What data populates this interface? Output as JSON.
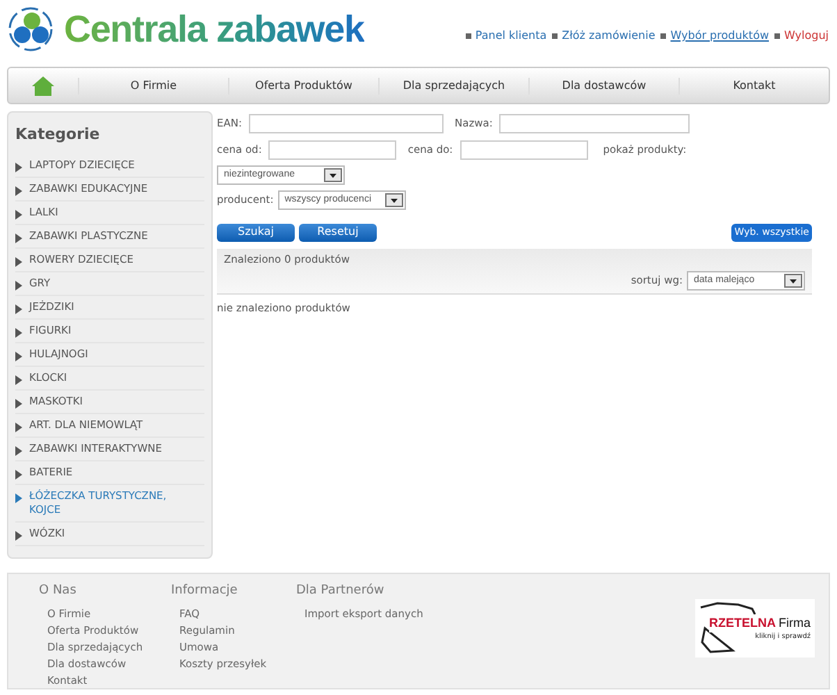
{
  "logo": {
    "text": "Centrala zabawek"
  },
  "top_links": [
    {
      "label": "Panel klienta",
      "kind": "normal"
    },
    {
      "label": "Złóż zamówienie",
      "kind": "normal"
    },
    {
      "label": "Wybór produktów",
      "kind": "current"
    },
    {
      "label": "Wyloguj",
      "kind": "logout"
    }
  ],
  "nav": [
    "O Firmie",
    "Oferta Produktów",
    "Dla sprzedających",
    "Dla dostawców",
    "Kontakt"
  ],
  "sidebar": {
    "title": "Kategorie",
    "items": [
      {
        "label": "LAPTOPY DZIECIĘCE",
        "selected": false
      },
      {
        "label": "ZABAWKI EDUKACYJNE",
        "selected": false
      },
      {
        "label": "LALKI",
        "selected": false
      },
      {
        "label": "ZABAWKI PLASTYCZNE",
        "selected": false
      },
      {
        "label": "ROWERY DZIECIĘCE",
        "selected": false
      },
      {
        "label": "GRY",
        "selected": false
      },
      {
        "label": "JEŻDZIKI",
        "selected": false
      },
      {
        "label": "FIGURKI",
        "selected": false
      },
      {
        "label": "HULAJNOGI",
        "selected": false
      },
      {
        "label": "KLOCKI",
        "selected": false
      },
      {
        "label": "MASKOTKI",
        "selected": false
      },
      {
        "label": "ART. DLA NIEMOWLĄT",
        "selected": false
      },
      {
        "label": "ZABAWKI INTERAKTYWNE",
        "selected": false
      },
      {
        "label": "BATERIE",
        "selected": false
      },
      {
        "label": "ŁÓŻECZKA TURYSTYCZNE, KOJCE",
        "selected": true
      },
      {
        "label": "WÓZKI",
        "selected": false
      }
    ]
  },
  "filters": {
    "ean_label": "EAN:",
    "name_label": "Nazwa:",
    "price_from_label": "cena od:",
    "price_to_label": "cena do:",
    "show_label": "pokaż produkty:",
    "show_value": "niezintegrowane",
    "producer_label": "producent:",
    "producer_value": "wszyscy producenci"
  },
  "buttons": {
    "search": "Szukaj",
    "reset": "Resetuj",
    "select_all": "Wyb. wszystkie"
  },
  "results": {
    "count": "Znaleziono 0 produktów",
    "sort_label": "sortuj wg:",
    "sort_value": "data malejąco",
    "empty": "nie znaleziono produktów"
  },
  "footer": {
    "columns": [
      {
        "title": "O Nas",
        "links": [
          "O Firmie",
          "Oferta Produktów",
          "Dla sprzedających",
          "Dla dostawców",
          "Kontakt"
        ]
      },
      {
        "title": "Informacje",
        "links": [
          "FAQ",
          "Regulamin",
          "Umowa",
          "Koszty przesyłek"
        ]
      },
      {
        "title": "Dla Partnerów",
        "links": [
          "Import eksport danych"
        ]
      }
    ],
    "badge": {
      "word_1": "RZETELNA",
      "word_2": "Firma",
      "caption": "kliknij i sprawdź"
    }
  }
}
